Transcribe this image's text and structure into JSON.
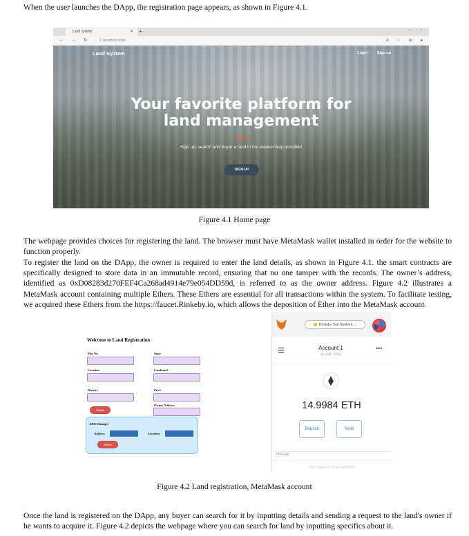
{
  "intro": "When the user launches the DApp, the registration page appears, as shown in Figure 4.1.",
  "figure1": {
    "browser": {
      "tab_title": "Land system",
      "url": "localhost:3000",
      "brand": "Land System",
      "nav_login": "Login",
      "nav_signup": "Sign up",
      "hero_title_line1": "Your favorite platform for",
      "hero_title_line2": "land management",
      "hero_subtitle": "Sign up, search and buyer a land in the easiest way possible!",
      "cta_label": "SIGN UP"
    },
    "caption": "Figure 4.1 Home page"
  },
  "paragraph1": "The webpage provides choices for registering the land. The browser must have MetaMask wallet installed in order for the website to function properly.",
  "paragraph2": "To register the land on the DApp, the owner is required to enter the land details, as shown in Figure 4.1. the smart contracts are specifically designed to store data in an immutable record, ensuring that no one tamper with the records. The owner’s address, identified as 0xD08283d270FEF4Ca268ad4914e79e054DD59d, is referred to as the owner address. Figure 4.2 illustrates a MetaMask account containing multiple Ethers. These Ethers are essential for all transactions within the system. To facilitate testing, we acquired these Ethers from the https://faucet.Rinkeby.io, which allows the deposition of Ether into the MetaMask account.",
  "figure2": {
    "form": {
      "title": "Welcome to Land Registration",
      "plot_no": "Plot No.",
      "state": "State",
      "location": "Location",
      "landmark": "Landmark",
      "district": "District",
      "price": "Price",
      "owner_address": "Owner Address",
      "submit": "Submit",
      "add_manager": "ADD Manager",
      "address": "Address",
      "mgr_location": "Location",
      "submit2": "Submit"
    },
    "metamask": {
      "network": "Rinkeby Test Network",
      "account_name": "Account 1",
      "account_addr": "0x1338...316d",
      "balance": "14.9984 ETH",
      "deposit": "Deposit",
      "send": "Send",
      "history": "History",
      "no_tx": "You have no transactions"
    },
    "caption": "Figure 4.2 Land registration, MetaMask account"
  },
  "paragraph3": "Once the land is registered on the DApp, any buyer can search for it by inputting details and sending a request to the land's owner if he wants to acquire it. Figure 4.2 depicts the webpage where you can search for land by inputting specifics about it."
}
